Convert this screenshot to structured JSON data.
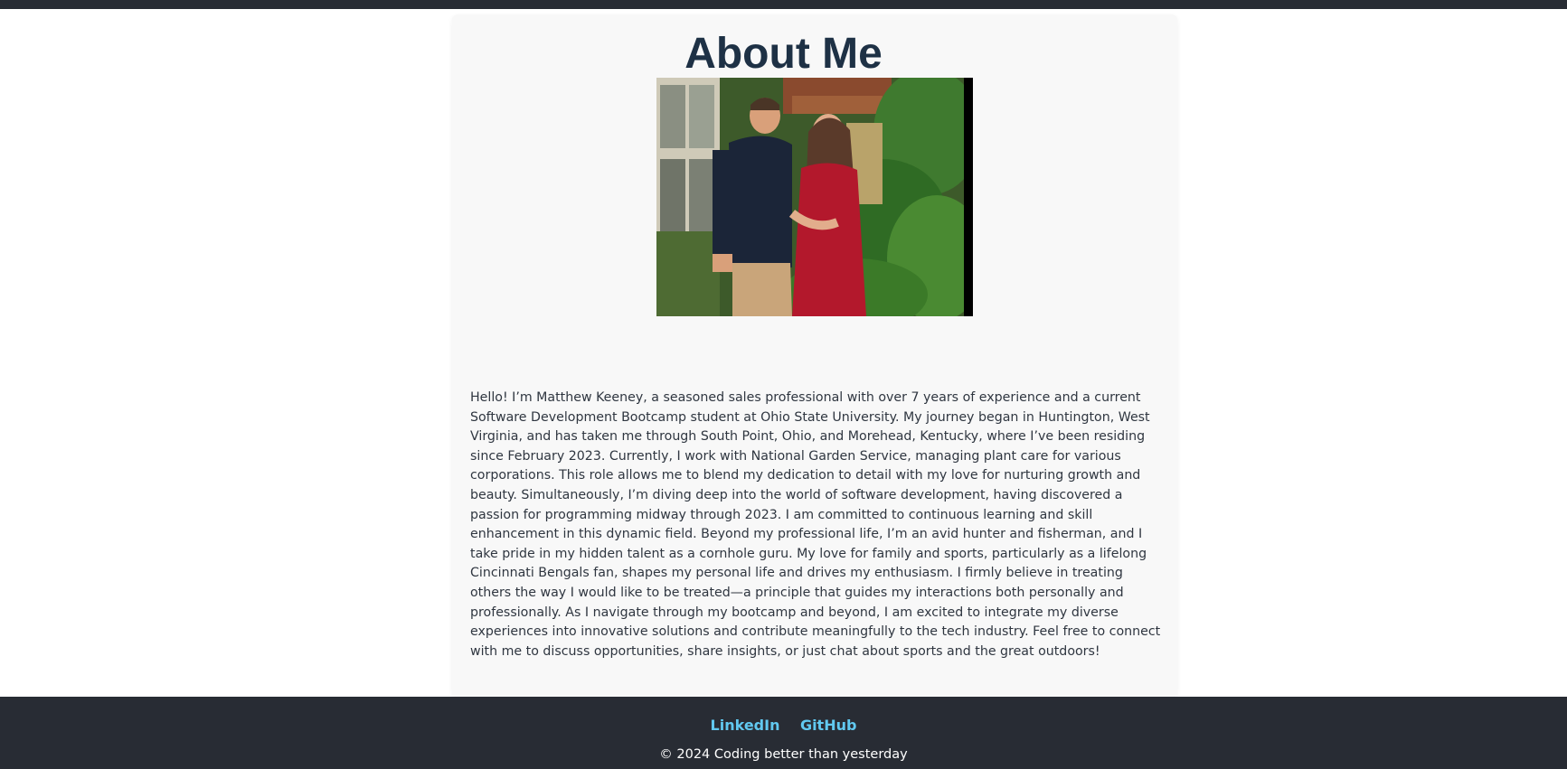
{
  "page": {
    "title": "About Me"
  },
  "photo": {
    "alt": "Photo of Matthew Keeney with partner"
  },
  "bio": {
    "text": "Hello! I’m Matthew Keeney, a seasoned sales professional with over 7 years of experience and a current Software Development Bootcamp student at Ohio State University. My journey began in Huntington, West Virginia, and has taken me through South Point, Ohio, and Morehead, Kentucky, where I’ve been residing since February 2023. Currently, I work with National Garden Service, managing plant care for various corporations. This role allows me to blend my dedication to detail with my love for nurturing growth and beauty. Simultaneously, I’m diving deep into the world of software development, having discovered a passion for programming midway through 2023. I am committed to continuous learning and skill enhancement in this dynamic field. Beyond my professional life, I’m an avid hunter and fisherman, and I take pride in my hidden talent as a cornhole guru. My love for family and sports, particularly as a lifelong Cincinnati Bengals fan, shapes my personal life and drives my enthusiasm. I firmly believe in treating others the way I would like to be treated—a principle that guides my interactions both personally and professionally. As I navigate through my bootcamp and beyond, I am excited to integrate my diverse experiences into innovative solutions and contribute meaningfully to the tech industry. Feel free to connect with me to discuss opportunities, share insights, or just chat about sports and the great outdoors!"
  },
  "footer": {
    "links": [
      {
        "label": "LinkedIn"
      },
      {
        "label": "GitHub"
      }
    ],
    "copyright": "© 2024 Coding better than yesterday"
  },
  "colors": {
    "header_footer_bg": "#282c34",
    "title": "#1e3145",
    "link": "#61c9f0",
    "card_bg": "#f8f8f8"
  }
}
